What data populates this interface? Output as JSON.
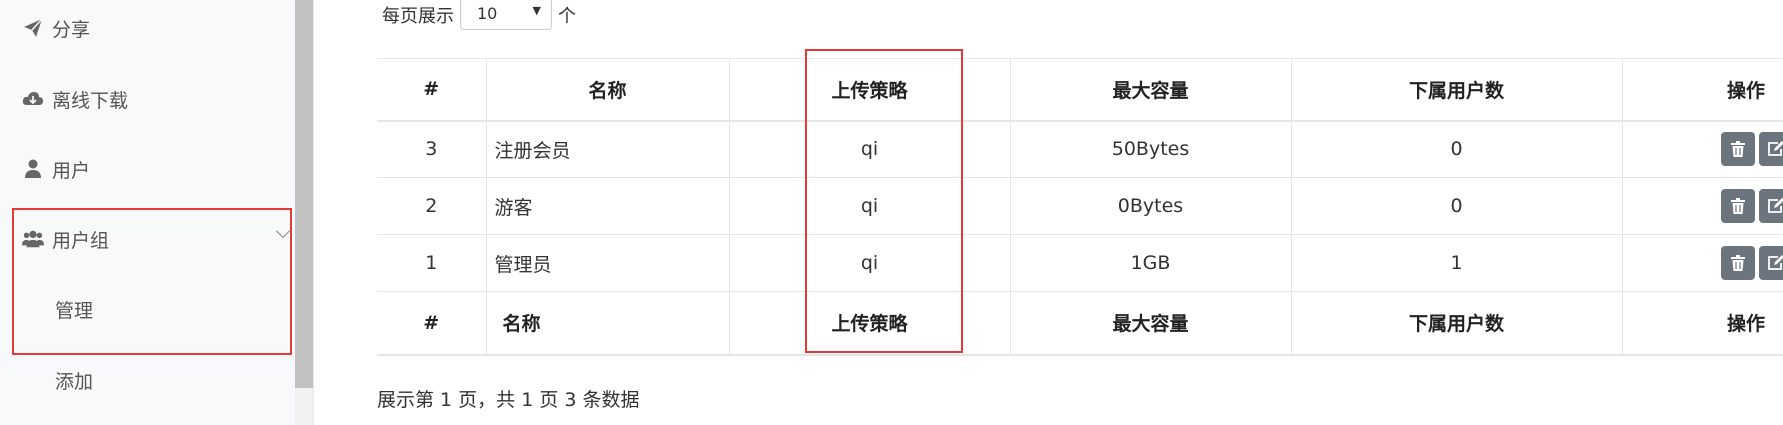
{
  "sidebar": {
    "items": [
      {
        "label": "分享",
        "icon": "paper-plane-icon"
      },
      {
        "label": "离线下载",
        "icon": "cloud-download-icon"
      },
      {
        "label": "用户",
        "icon": "user-icon"
      },
      {
        "label": "用户组",
        "icon": "users-icon",
        "expanded": true
      }
    ],
    "subitems": [
      {
        "label": "管理"
      },
      {
        "label": "添加"
      }
    ]
  },
  "per_page": {
    "prefix": "每页展示",
    "value": "10",
    "suffix": "个"
  },
  "table": {
    "columns": [
      "#",
      "名称",
      "上传策略",
      "最大容量",
      "下属用户数",
      "操作"
    ],
    "rows": [
      {
        "id": "3",
        "name": "注册会员",
        "policy": "qi",
        "capacity": "50Bytes",
        "users": "0"
      },
      {
        "id": "2",
        "name": "游客",
        "policy": "qi",
        "capacity": "0Bytes",
        "users": "0"
      },
      {
        "id": "1",
        "name": "管理员",
        "policy": "qi",
        "capacity": "1GB",
        "users": "1"
      }
    ],
    "action_icons": [
      "trash-icon",
      "edit-icon"
    ]
  },
  "pagination": {
    "text": "展示第 1 页，共 1 页 3 条数据"
  },
  "colors": {
    "highlight": "#e53935",
    "action_button": "#6c757d",
    "sidebar_bg": "#f8f9fa"
  }
}
